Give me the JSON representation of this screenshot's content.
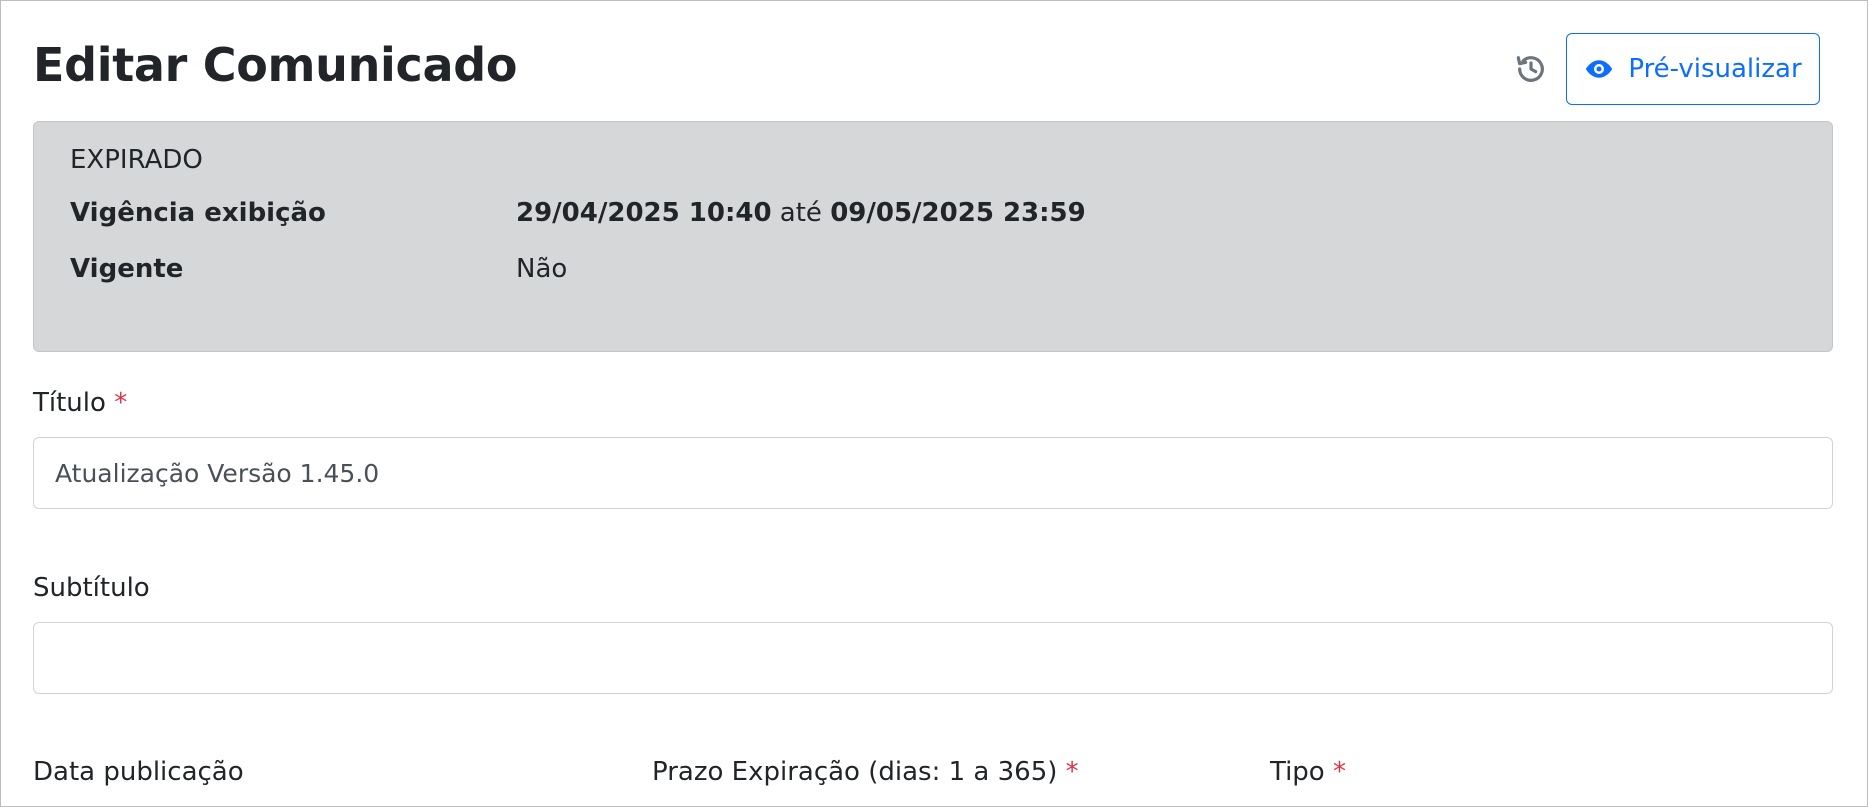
{
  "header": {
    "title": "Editar Comunicado",
    "history_icon": "history-icon",
    "preview_icon": "eye-icon",
    "preview_label": "Pré-visualizar",
    "accent_color": "#0d6efd"
  },
  "status_card": {
    "status": "EXPIRADO",
    "vigencia_label": "Vigência exibição",
    "vigencia_start": "29/04/2025 10:40",
    "vigencia_connector": "até",
    "vigencia_end": "09/05/2025 23:59",
    "vigente_label": "Vigente",
    "vigente_value": "Não",
    "background_color": "#d6d7d9"
  },
  "form": {
    "titulo": {
      "label": "Título",
      "required_mark": "*",
      "value": "Atualização Versão 1.45.0"
    },
    "subtitulo": {
      "label": "Subtítulo",
      "value": ""
    },
    "data_publicacao": {
      "label": "Data publicação"
    },
    "prazo_expiracao": {
      "label": "Prazo Expiração (dias: 1 a 365)",
      "required_mark": "*"
    },
    "tipo": {
      "label": "Tipo",
      "required_mark": "*"
    },
    "required_color": "#dc3545"
  }
}
